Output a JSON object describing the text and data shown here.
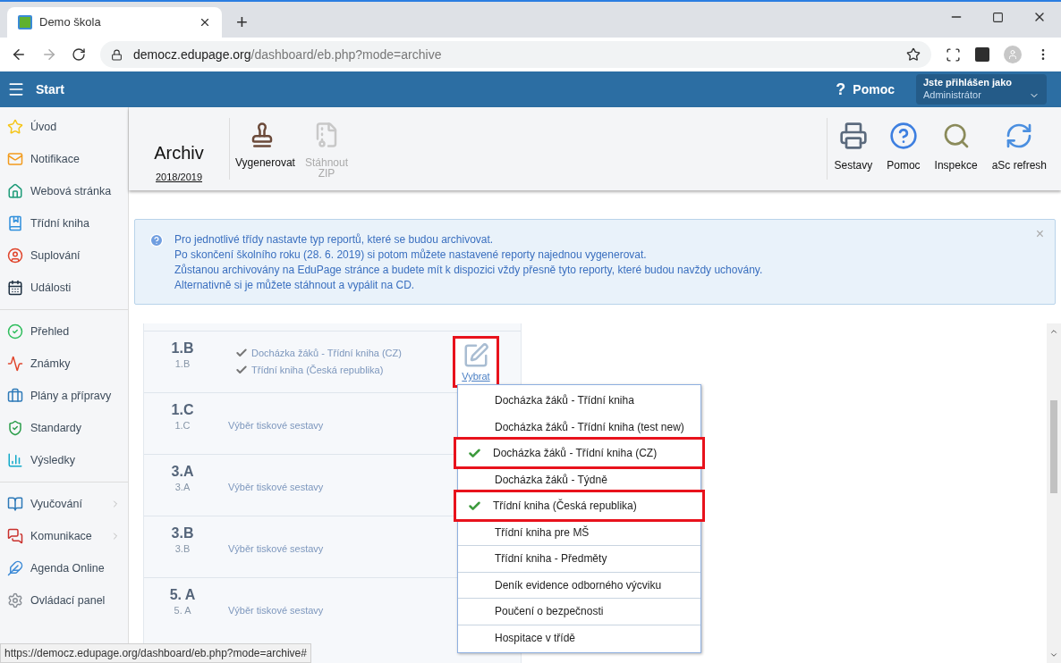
{
  "browser": {
    "tab_title": "Demo škola",
    "new_tab_symbol": "+",
    "url_domain": "democz.edupage.org",
    "url_path": "/dashboard/eb.php?mode=archive"
  },
  "header": {
    "menu_label": "Start",
    "help_symbol": "?",
    "help_label": "Pomoc",
    "user": {
      "caption": "Jste přihlášen jako",
      "name": "Administrátor"
    }
  },
  "sidebar": {
    "groups": [
      [
        {
          "label": "Úvod",
          "submenu": false
        },
        {
          "label": "Notifikace",
          "submenu": false
        },
        {
          "label": "Webová stránka",
          "submenu": false
        },
        {
          "label": "Třídní kniha",
          "submenu": false
        },
        {
          "label": "Suplování",
          "submenu": false
        },
        {
          "label": "Události",
          "submenu": false
        }
      ],
      [
        {
          "label": "Přehled",
          "submenu": false
        },
        {
          "label": "Známky",
          "submenu": false
        },
        {
          "label": "Plány a přípravy",
          "submenu": false
        },
        {
          "label": "Standardy",
          "submenu": false
        },
        {
          "label": "Výsledky",
          "submenu": false
        }
      ],
      [
        {
          "label": "Vyučování",
          "submenu": true
        },
        {
          "label": "Komunikace",
          "submenu": true
        },
        {
          "label": "Agenda Online",
          "submenu": false
        },
        {
          "label": "Ovládací panel",
          "submenu": false
        }
      ]
    ]
  },
  "toolbar": {
    "title": "Archiv",
    "year": "2018/2019",
    "left_actions": [
      {
        "label": "Vygenerovat",
        "disabled": false
      },
      {
        "label": "Stáhnout ZIP",
        "disabled": true
      }
    ],
    "right_actions": [
      {
        "label": "Sestavy"
      },
      {
        "label": "Pomoc"
      },
      {
        "label": "Inspekce"
      },
      {
        "label": "aSc refresh"
      }
    ]
  },
  "info": {
    "lines": [
      "Pro jednotlivé třídy nastavte typ reportů, které se budou archivovat.",
      "Po skončení školního roku (28. 6. 2019) si potom můžete nastavené reporty najednou vygenerovat.",
      "Zůstanou archivovány na EduPage stránce a budete mít k dispozici vždy přesně tyto reporty, které budou navždy uchovány.",
      "Alternativně si je můžete stáhnout a vypálit na CD."
    ],
    "close_symbol": "×"
  },
  "classes": [
    {
      "name": "1.B",
      "short": "1.B",
      "kind": "reports",
      "reports": [
        "Docházka žáků - Třídní kniha (CZ)",
        "Třídní kniha (Česká republika)"
      ],
      "edit_button": {
        "label": "Vybrat",
        "highlighted": true
      }
    },
    {
      "name": "1.C",
      "short": "1.C",
      "kind": "link",
      "link": "Výběr tiskové sestavy"
    },
    {
      "name": "3.A",
      "short": "3.A",
      "kind": "link",
      "link": "Výběr tiskové sestavy"
    },
    {
      "name": "3.B",
      "short": "3.B",
      "kind": "link",
      "link": "Výběr tiskové sestavy"
    },
    {
      "name": "5. A",
      "short": "5. A",
      "kind": "link",
      "link": "Výběr tiskové sestavy"
    }
  ],
  "dropdown": [
    {
      "label": "Docházka žáků - Třídní kniha",
      "checked": false,
      "highlighted": false,
      "divider_above": false
    },
    {
      "label": "Docházka žáků - Třídní kniha (test new)",
      "checked": false,
      "highlighted": false,
      "divider_above": false
    },
    {
      "label": "Docházka žáků - Třídní kniha (CZ)",
      "checked": true,
      "highlighted": true,
      "divider_above": false
    },
    {
      "label": "Docházka žáků - Týdně",
      "checked": false,
      "highlighted": false,
      "divider_above": false
    },
    {
      "label": "Třídní kniha (Česká republika)",
      "checked": true,
      "highlighted": true,
      "divider_above": false
    },
    {
      "label": "Třídní kniha pre MŠ",
      "checked": false,
      "highlighted": false,
      "divider_above": false
    },
    {
      "label": "Třídní kniha - Předměty",
      "checked": false,
      "highlighted": false,
      "divider_above": true
    },
    {
      "label": "Deník evidence odborného výcviku",
      "checked": false,
      "highlighted": false,
      "divider_above": true
    },
    {
      "label": "Poučení o bezpečnosti",
      "checked": false,
      "highlighted": false,
      "divider_above": true
    },
    {
      "label": "Hospitace v třídě",
      "checked": false,
      "highlighted": false,
      "divider_above": true
    }
  ],
  "status_url": "https://democz.edupage.org/dashboard/eb.php?mode=archive#"
}
